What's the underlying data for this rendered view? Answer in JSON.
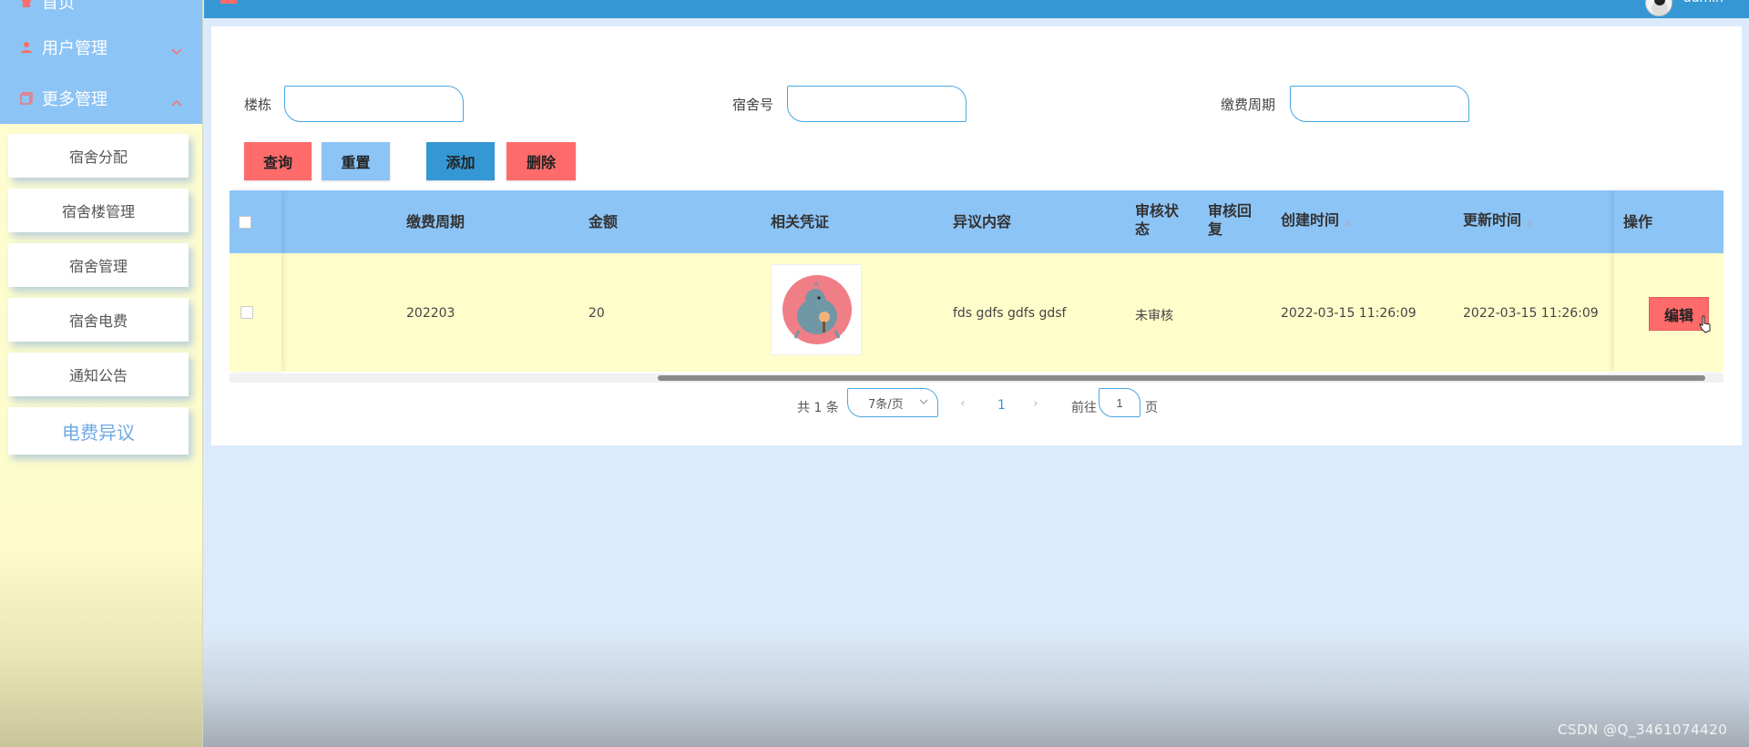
{
  "sidebar": {
    "home_label": "首页",
    "user_mgmt_label": "用户管理",
    "more_mgmt_label": "更多管理",
    "sub_items": [
      {
        "label": "宿舍分配"
      },
      {
        "label": "宿舍楼管理"
      },
      {
        "label": "宿舍管理"
      },
      {
        "label": "宿舍电费"
      },
      {
        "label": "通知公告"
      },
      {
        "label": "电费异议"
      }
    ]
  },
  "header": {
    "username": "admin"
  },
  "filters": {
    "building_label": "楼栋",
    "dorm_no_label": "宿舍号",
    "period_label": "缴费周期",
    "building_value": "",
    "dorm_no_value": "",
    "period_value": ""
  },
  "actions": {
    "query": "查询",
    "reset": "重置",
    "add": "添加",
    "delete": "删除"
  },
  "table": {
    "columns": {
      "period": "缴费周期",
      "amount": "金额",
      "voucher": "相关凭证",
      "objection": "异议内容",
      "review_status_1": "审核状",
      "review_status_2": "态",
      "review_reply_1": "审核回",
      "review_reply_2": "复",
      "created": "创建时间",
      "updated": "更新时间",
      "ops": "操作"
    },
    "rows": [
      {
        "period": "202203",
        "amount": "20",
        "objection": "fds gdfs gdfs gdsf",
        "review_status": "未审核",
        "review_reply": "",
        "created": "2022-03-15 11:26:09",
        "updated": "2022-03-15 11:26:09",
        "edit_label": "编辑"
      }
    ]
  },
  "pagination": {
    "total_text": "共 1 条",
    "page_size": "7条/页",
    "current_page": "1",
    "goto_label": "前往",
    "page_unit": "页",
    "goto_value": "1"
  },
  "watermark": "CSDN @Q_3461074420",
  "colors": {
    "header_bg": "#3598d4",
    "sidebar_top": "#8cc4f6",
    "sidebar_bg": "#fffed2",
    "table_head": "#8cc4f6",
    "row_bg": "#fffecb",
    "danger": "#ff6b6b"
  }
}
